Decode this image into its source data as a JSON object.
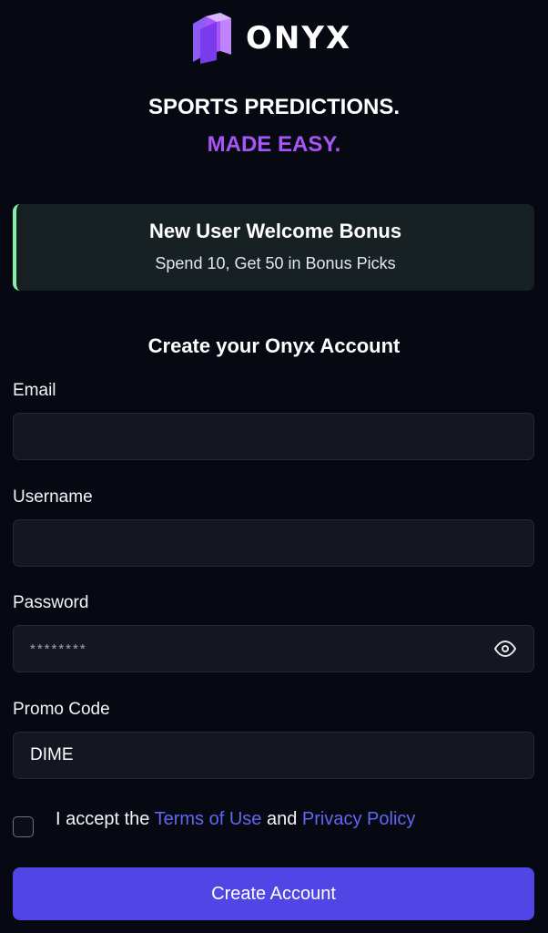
{
  "brand": {
    "name": "ONYX",
    "logo_icon": "onyx-logo-icon",
    "colors": {
      "primary": "#a855f7",
      "accent_dark": "#7c3aed",
      "background": "#060912"
    }
  },
  "tagline": {
    "line1": "SPORTS PREDICTIONS.",
    "line2": "MADE EASY."
  },
  "bonus": {
    "title": "New User Welcome Bonus",
    "subtitle": "Spend 10, Get 50 in Bonus Picks",
    "accent_color": "#86efac"
  },
  "form": {
    "heading": "Create your Onyx Account",
    "email": {
      "label": "Email",
      "value": ""
    },
    "username": {
      "label": "Username",
      "value": ""
    },
    "password": {
      "label": "Password",
      "value": "********",
      "toggle_icon": "eye-icon"
    },
    "promo": {
      "label": "Promo Code",
      "value": "DIME"
    },
    "terms": {
      "prefix": "I accept the",
      "terms_link": "Terms of Use",
      "connector": "and",
      "privacy_link": "Privacy Policy",
      "checked": false
    },
    "submit_label": "Create Account",
    "submit_color": "#4f46e5"
  }
}
